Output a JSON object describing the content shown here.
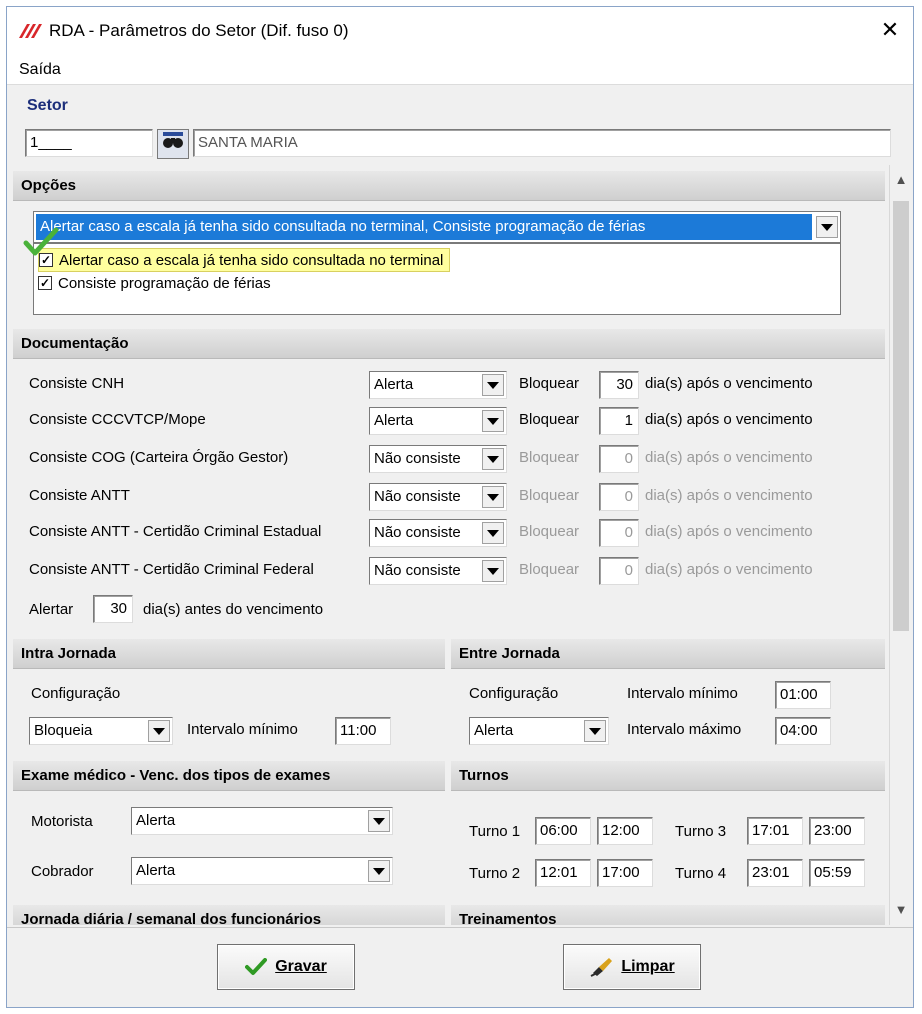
{
  "window": {
    "title": "RDA - Parâmetros do Setor (Dif. fuso 0)",
    "close_glyph": "✕"
  },
  "menu": {
    "saida": "Saída"
  },
  "setor": {
    "label": "Setor",
    "code": "1____",
    "name": "SANTA MARIA"
  },
  "opcoes": {
    "header": "Opções",
    "selected_text": "Alertar caso a escala já tenha sido consultada no terminal, Consiste programação de férias",
    "items": [
      {
        "label": "Alertar caso a escala já tenha sido consultada no terminal",
        "checked": true
      },
      {
        "label": "Consiste programação de férias",
        "checked": true
      }
    ]
  },
  "documentacao": {
    "header": "Documentação",
    "bloquear_label": "Bloquear",
    "apos_label": "dia(s) após o vencimento",
    "rows": [
      {
        "label": "Consiste CNH",
        "combo": "Alerta",
        "days": "30",
        "enabled": true
      },
      {
        "label": "Consiste CCCVTCP/Mope",
        "combo": "Alerta",
        "days": "1",
        "enabled": true
      },
      {
        "label": "Consiste COG (Carteira Órgão Gestor)",
        "combo": "Não consiste",
        "days": "0",
        "enabled": false
      },
      {
        "label": "Consiste ANTT",
        "combo": "Não consiste",
        "days": "0",
        "enabled": false
      },
      {
        "label": "Consiste ANTT - Certidão Criminal Estadual",
        "combo": "Não consiste",
        "days": "0",
        "enabled": false
      },
      {
        "label": "Consiste ANTT - Certidão Criminal Federal",
        "combo": "Não consiste",
        "days": "0",
        "enabled": false
      }
    ],
    "alertar_label": "Alertar",
    "alertar_days": "30",
    "antes_label": "dia(s) antes do vencimento"
  },
  "intra": {
    "header": "Intra Jornada",
    "config_label": "Configuração",
    "config_value": "Bloqueia",
    "intervalo_label": "Intervalo mínimo",
    "intervalo_value": "11:00"
  },
  "entre": {
    "header": "Entre Jornada",
    "config_label": "Configuração",
    "config_value": "Alerta",
    "min_label": "Intervalo mínimo",
    "min_value": "01:00",
    "max_label": "Intervalo máximo",
    "max_value": "04:00"
  },
  "exame": {
    "header": "Exame médico - Venc. dos tipos de exames",
    "motorista_label": "Motorista",
    "motorista_value": "Alerta",
    "cobrador_label": "Cobrador",
    "cobrador_value": "Alerta"
  },
  "turnos": {
    "header": "Turnos",
    "items": [
      {
        "label": "Turno 1",
        "start": "06:00",
        "end": "12:00"
      },
      {
        "label": "Turno 2",
        "start": "12:01",
        "end": "17:00"
      },
      {
        "label": "Turno 3",
        "start": "17:01",
        "end": "23:00"
      },
      {
        "label": "Turno 4",
        "start": "23:01",
        "end": "05:59"
      }
    ]
  },
  "jornada_header": "Jornada diária / semanal dos funcionários",
  "treinamentos_header": "Treinamentos",
  "buttons": {
    "gravar": "Gravar",
    "limpar": "Limpar"
  },
  "colors": {
    "accent": "#1c7ad8",
    "setor_label": "#1c2e7a",
    "highlight": "#ffff9e"
  }
}
